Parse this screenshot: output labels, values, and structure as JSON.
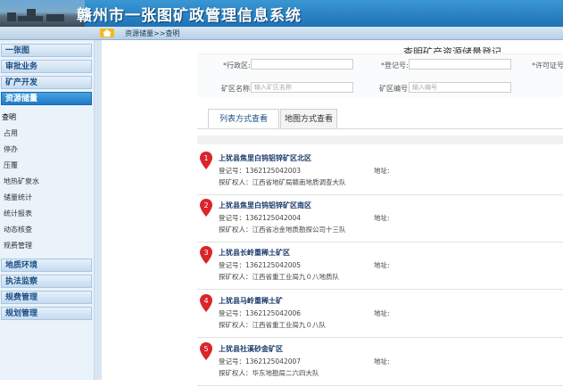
{
  "app": {
    "title": "赣州市一张图矿政管理信息系统"
  },
  "breadcrumb": {
    "text": "资源储量>>查明"
  },
  "sidebar": {
    "sections": [
      {
        "label": "一张图"
      },
      {
        "label": "审批业务"
      },
      {
        "label": "矿产开发"
      },
      {
        "label": "资源储量"
      },
      {
        "label": "地质环境"
      },
      {
        "label": "执法监察"
      },
      {
        "label": "规费管理"
      },
      {
        "label": "规划管理"
      }
    ],
    "subitems": [
      "查明",
      "占用",
      "停办",
      "压覆",
      "地热矿泉水",
      "储量统计",
      "统计报表",
      "动态核查",
      "规费管理"
    ]
  },
  "page": {
    "title": "查明矿产资源储量登记"
  },
  "form": {
    "admin_region_label": "*行政区:",
    "reg_no_label": "*登记号:",
    "permit_no_label": "*许可证号:",
    "mine_name_label": "矿区名称:",
    "mine_name_placeholder": "输入矿区名称",
    "mine_no_label": "矿区编号:",
    "mine_no_placeholder": "输入编号"
  },
  "tabs": [
    {
      "label": "列表方式查看",
      "active": true
    },
    {
      "label": "地图方式查看",
      "active": false
    }
  ],
  "results": [
    {
      "num": "1",
      "name": "上犹县焦里白钨铝锌矿区北区",
      "code": "登记号：1362125042003",
      "owner": "探矿权人：江西省地矿局赣南地质调查大队",
      "addr": "地址:"
    },
    {
      "num": "2",
      "name": "上犹县焦里白钨铝锌矿区南区",
      "code": "登记号：1362125042004",
      "owner": "探矿权人：江西省冶金地质勘探公司十三队",
      "addr": "地址:"
    },
    {
      "num": "3",
      "name": "上犹县长岭重稀土矿区",
      "code": "登记号：1362125042005",
      "owner": "探矿权人：江西省重工业局九０八地质队",
      "addr": "地址:"
    },
    {
      "num": "4",
      "name": "上犹县马岭重稀土矿",
      "code": "登记号：1362125042006",
      "owner": "探矿权人：江西省重工业局九０八队",
      "addr": "地址:"
    },
    {
      "num": "5",
      "name": "上犹县社溪砂金矿区",
      "code": "登记号：1362125042007",
      "owner": "探矿权人：华东地勘局二六四大队",
      "addr": "地址:"
    }
  ],
  "colors": {
    "header": "#1f73b6",
    "active_nav": "#1f7ac8",
    "pin": "#d9252b"
  }
}
